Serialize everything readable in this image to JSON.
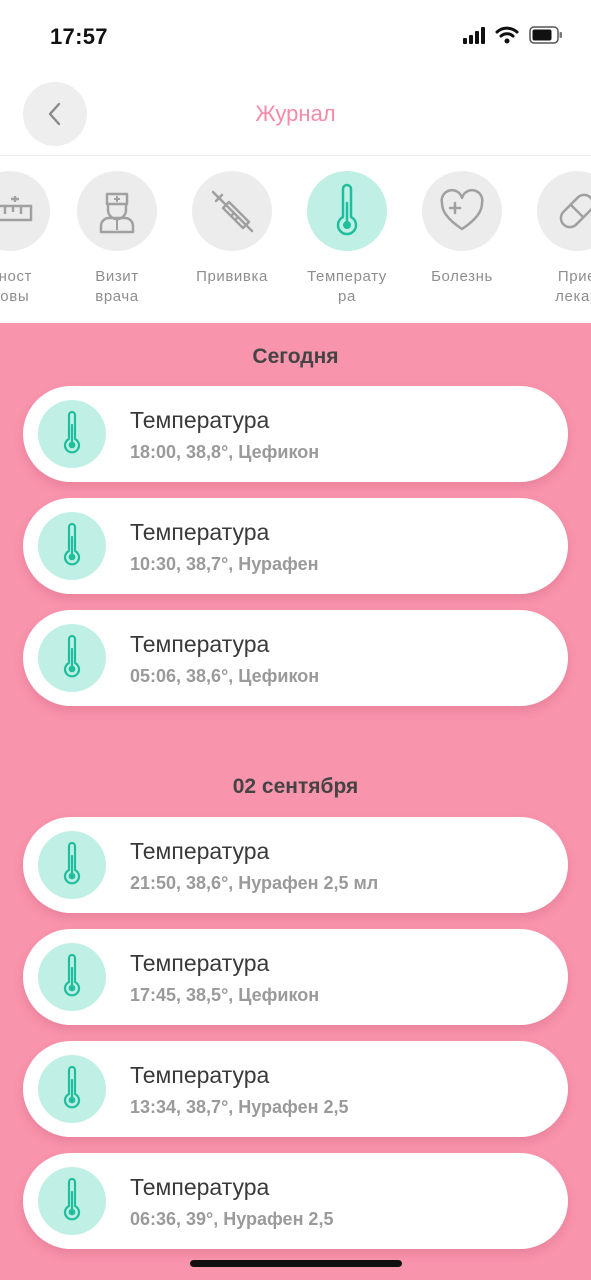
{
  "status_bar": {
    "time": "17:57"
  },
  "header": {
    "title": "Журнал"
  },
  "categories": [
    {
      "label": "жност\nловы",
      "icon": "ruler-icon"
    },
    {
      "label": "Визит\nврача",
      "icon": "doctor-icon"
    },
    {
      "label": "Прививка",
      "icon": "syringe-icon"
    },
    {
      "label": "Температу\nра",
      "icon": "thermometer-icon",
      "active": true
    },
    {
      "label": "Болезнь",
      "icon": "heart-plus-icon"
    },
    {
      "label": "Прие\nлекар",
      "icon": "pill-icon"
    }
  ],
  "sections": [
    {
      "title": "Сегодня",
      "entries": [
        {
          "title": "Температура",
          "subtitle": "18:00, 38,8°, Цефикон"
        },
        {
          "title": "Температура",
          "subtitle": "10:30, 38,7°, Нурафен"
        },
        {
          "title": "Температура",
          "subtitle": "05:06, 38,6°, Цефикон"
        }
      ]
    },
    {
      "title": "02 сентября",
      "entries": [
        {
          "title": "Температура",
          "subtitle": "21:50, 38,6°, Нурафен 2,5 мл"
        },
        {
          "title": "Температура",
          "subtitle": "17:45, 38,5°, Цефикон"
        },
        {
          "title": "Температура",
          "subtitle": "13:34, 38,7°, Нурафен 2,5"
        },
        {
          "title": "Температура",
          "subtitle": "06:36, 39°, Нурафен 2,5"
        }
      ]
    }
  ],
  "colors": {
    "accent_pink": "#f68aa8",
    "list_background": "#f994ad",
    "mint": "#c0efe6",
    "icon_teal": "#1fbf9d"
  }
}
